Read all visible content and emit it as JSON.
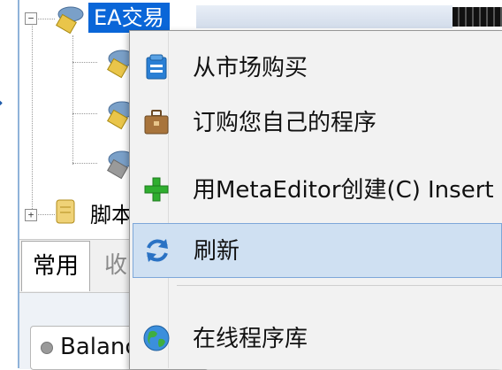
{
  "navigator": {
    "ea_node_label": "EA交易",
    "scripts_node_label": "脚本",
    "expand_minus": "−",
    "expand_plus": "+"
  },
  "tabs": {
    "common": "常用",
    "favorites_partial": "收"
  },
  "account": {
    "balance_label": "Balance"
  },
  "context_menu": {
    "items": [
      {
        "label": "从市场购买",
        "icon": "market-bag-icon"
      },
      {
        "label": "订购您自己的程序",
        "icon": "briefcase-icon"
      },
      {
        "label": "用MetaEditor创建(C)",
        "shortcut": "Insert",
        "icon": "green-plus-icon"
      },
      {
        "label": "刷新",
        "icon": "refresh-icon",
        "highlighted": true
      },
      {
        "label": "在线程序库",
        "icon": "globe-icon"
      }
    ]
  },
  "colors": {
    "selection": "#0a66d8",
    "menu_highlight": "#cfe0f2",
    "menu_highlight_border": "#7da7d9",
    "menu_bg": "#f2f2f2"
  }
}
